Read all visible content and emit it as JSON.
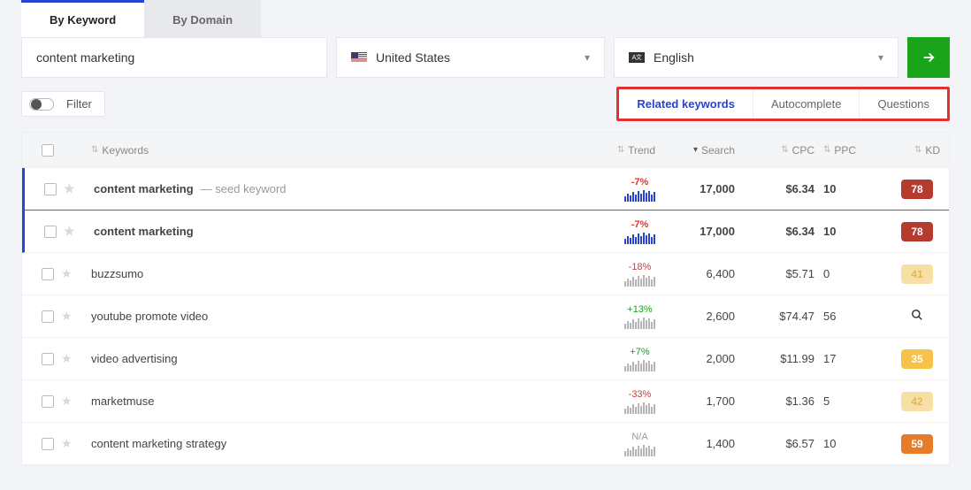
{
  "tabs": {
    "byKeyword": "By Keyword",
    "byDomain": "By Domain"
  },
  "search": {
    "keyword": "content marketing",
    "country": "United States",
    "language": "English"
  },
  "filter": {
    "label": "Filter"
  },
  "subtabs": {
    "related": "Related keywords",
    "auto": "Autocomplete",
    "questions": "Questions"
  },
  "columns": {
    "keywords": "Keywords",
    "trend": "Trend",
    "search": "Search",
    "cpc": "CPC",
    "ppc": "PPC",
    "kd": "KD"
  },
  "rows": [
    {
      "keyword": "content marketing",
      "seed": true,
      "seedTag": "— seed keyword",
      "trendPct": "-7%",
      "trendDir": "neg",
      "barColor": "blue",
      "search": "17,000",
      "cpc": "$6.34",
      "ppc": "10",
      "kd": "78",
      "kdClass": "kd-red",
      "bold": true
    },
    {
      "keyword": "content marketing",
      "seed": false,
      "trendPct": "-7%",
      "trendDir": "neg",
      "barColor": "blue",
      "search": "17,000",
      "cpc": "$6.34",
      "ppc": "10",
      "kd": "78",
      "kdClass": "kd-red",
      "bold": true,
      "highlight": true
    },
    {
      "keyword": "buzzsumo",
      "trendPct": "-18%",
      "trendDir": "neg",
      "barColor": "grey",
      "search": "6,400",
      "cpc": "$5.71",
      "ppc": "0",
      "kd": "41",
      "kdClass": "kd-cream"
    },
    {
      "keyword": "youtube promote video",
      "trendPct": "+13%",
      "trendDir": "pos",
      "barColor": "grey",
      "search": "2,600",
      "cpc": "$74.47",
      "ppc": "56",
      "kd": null,
      "kdIcon": true
    },
    {
      "keyword": "video advertising",
      "trendPct": "+7%",
      "trendDir": "pos",
      "barColor": "grey",
      "search": "2,000",
      "cpc": "$11.99",
      "ppc": "17",
      "kd": "35",
      "kdClass": "kd-yellow"
    },
    {
      "keyword": "marketmuse",
      "trendPct": "-33%",
      "trendDir": "neg",
      "barColor": "grey",
      "search": "1,700",
      "cpc": "$1.36",
      "ppc": "5",
      "kd": "42",
      "kdClass": "kd-cream"
    },
    {
      "keyword": "content marketing strategy",
      "trendPct": "N/A",
      "trendDir": "na",
      "barColor": "grey",
      "search": "1,400",
      "cpc": "$6.57",
      "ppc": "10",
      "kd": "59",
      "kdClass": "kd-orange"
    }
  ]
}
